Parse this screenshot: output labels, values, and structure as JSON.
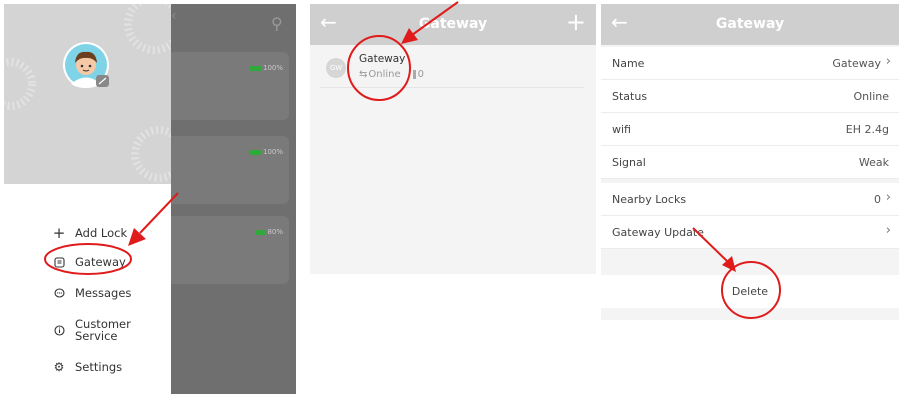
{
  "panel1": {
    "menu": [
      {
        "icon": "plus-icon",
        "label": "Add Lock"
      },
      {
        "icon": "gateway-icon",
        "label": "Gateway"
      },
      {
        "icon": "chat-bubble-icon",
        "label": "Messages"
      },
      {
        "icon": "info-icon",
        "label": "Customer Service"
      },
      {
        "icon": "gear-icon",
        "label": "Settings"
      }
    ],
    "locks": [
      {
        "battery": "100%",
        "battery_fraction": 1.0
      },
      {
        "battery": "100%",
        "battery_fraction": 1.0
      },
      {
        "battery": "80%",
        "battery_fraction": 0.8
      }
    ]
  },
  "panel2": {
    "title": "Gateway",
    "item": {
      "avatar": "GW",
      "name": "Gateway",
      "status": "Online",
      "count": "0"
    }
  },
  "panel3": {
    "title": "Gateway",
    "rows": [
      {
        "label": "Name",
        "value": "Gateway"
      },
      {
        "label": "Status",
        "value": "Online"
      },
      {
        "label": "wifi",
        "value": "EH 2.4g"
      },
      {
        "label": "Signal",
        "value": "Weak"
      }
    ],
    "nearby": {
      "label": "Nearby Locks",
      "value": "0"
    },
    "update": {
      "label": "Gateway Update"
    },
    "delete_label": "Delete"
  },
  "colors": {
    "annotation": "#e01b1b",
    "header_bar": "#cfcfcf",
    "battery": "#2faa3a"
  }
}
